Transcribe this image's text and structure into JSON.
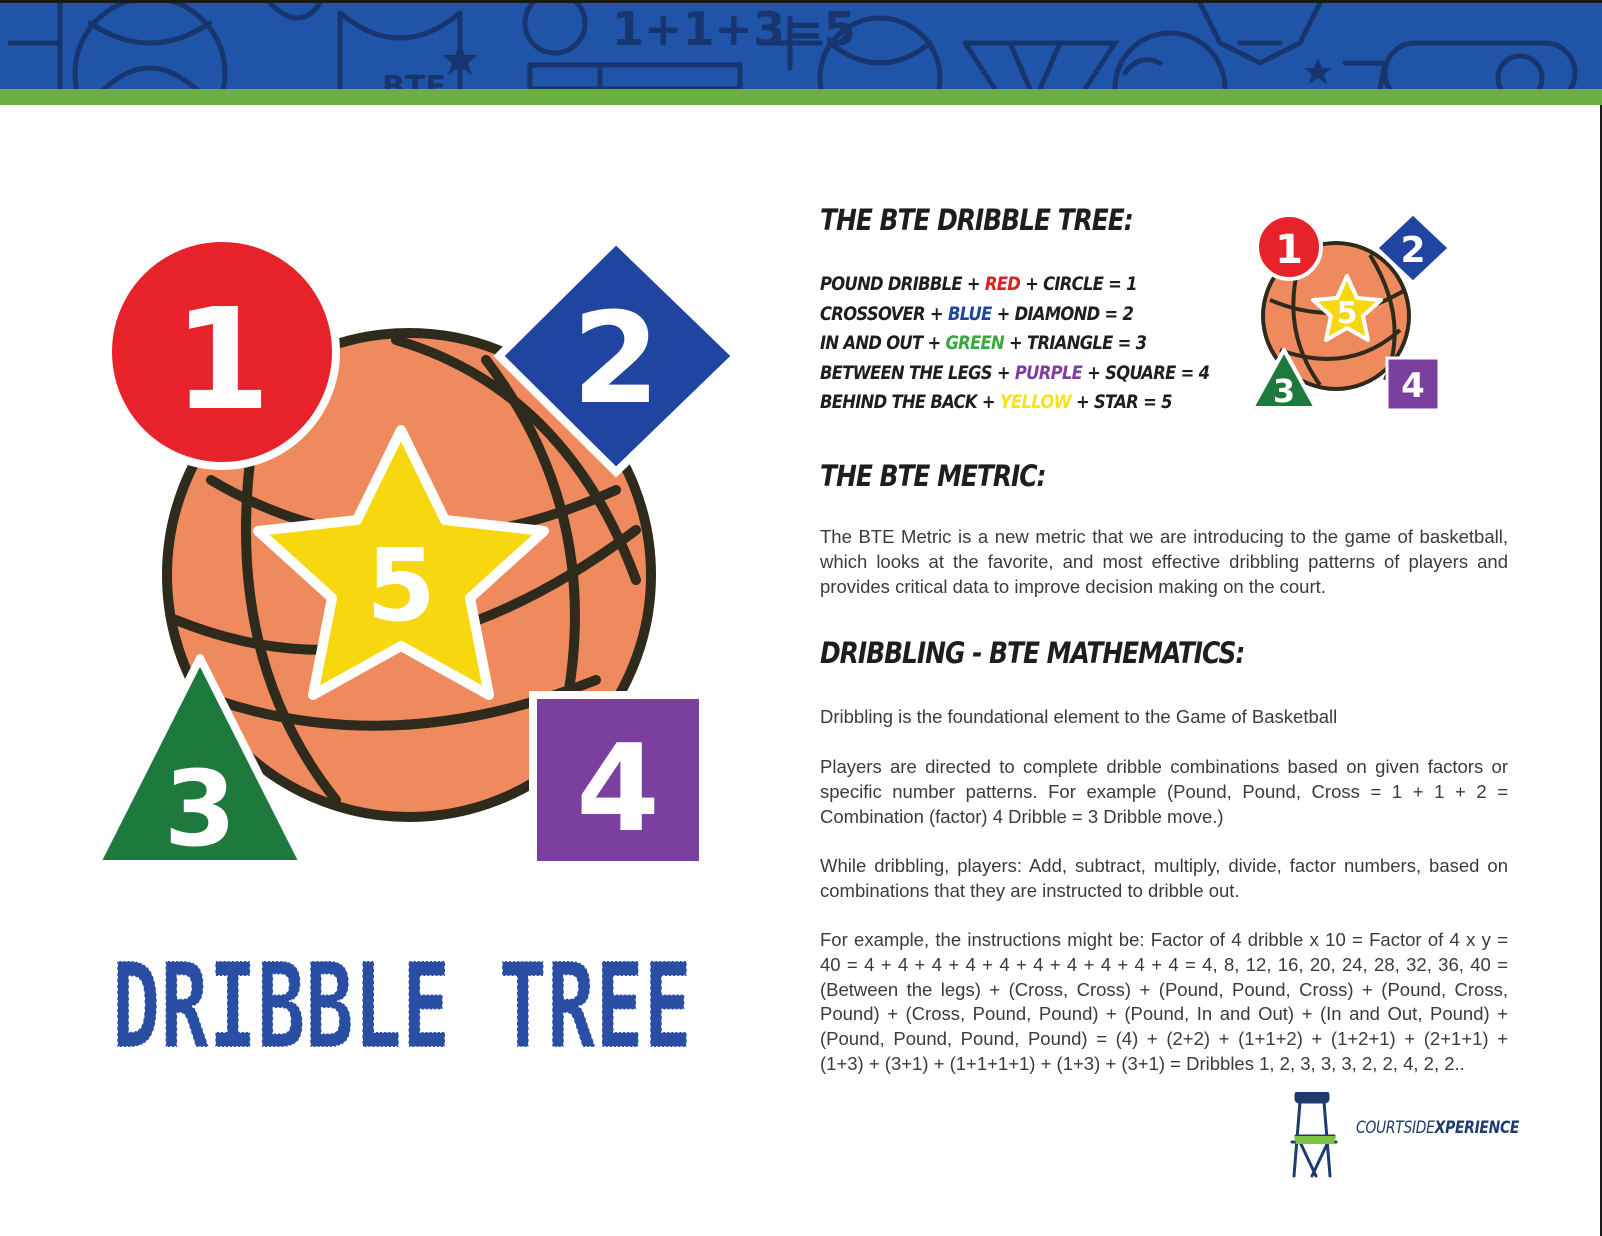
{
  "banner": {
    "equation": "1+1+3=5",
    "jersey_text": "BTE"
  },
  "tree": {
    "heading": "THE BTE DRIBBLE TREE:",
    "rows": [
      {
        "move": "POUND DRIBBLE + ",
        "color_word": "RED",
        "color": "#e02020",
        "rest": " + CIRCLE = 1"
      },
      {
        "move": "CROSSOVER + ",
        "color_word": "BLUE",
        "color": "#1f45a0",
        "rest": " + DIAMOND = 2"
      },
      {
        "move": "IN AND OUT + ",
        "color_word": "GREEN",
        "color": "#3aa83a",
        "rest": " + TRIANGLE = 3"
      },
      {
        "move": "BETWEEN THE LEGS + ",
        "color_word": "PURPLE",
        "color": "#7b3fa0",
        "rest": " + SQUARE = 4"
      },
      {
        "move": "BEHIND THE BACK + ",
        "color_word": "YELLOW",
        "color": "#f5e21a",
        "rest": " + STAR = 5"
      }
    ]
  },
  "metric": {
    "heading": "THE BTE METRIC:",
    "text": "The BTE Metric is a new metric that we are introducing to the game of basketball, which looks at the favorite, and most effective dribbling patterns of players and provides critical data to improve decision making on the court."
  },
  "math": {
    "heading": "DRIBBLING - BTE MATHEMATICS:",
    "p1": "Dribbling is the foundational element to the Game of Basketball",
    "p2": "Players are directed to complete dribble combinations based on given factors or specific number patterns. For example (Pound, Pound, Cross = 1 + 1 + 2 = Combination (factor) 4 Dribble = 3 Dribble move.)",
    "p3": "While dribbling, players: Add, subtract, multiply, divide, factor numbers, based on combinations that they are instructed to dribble out.",
    "p4": "For example, the instructions might be: Factor of 4 dribble x 10 = Factor of 4 x y = 40  = 4 + 4 + 4 + 4 + 4 + 4 + 4 + 4 + 4 + 4 = 4, 8, 12, 16, 20, 24, 28, 32, 36, 40 = (Between the legs) + (Cross, Cross)  + (Pound, Pound, Cross) + (Pound, Cross, Pound) + (Cross, Pound, Pound) + (Pound, In and Out) + (In and Out, Pound) + (Pound, Pound, Pound, Pound) = (4) + (2+2) + (1+1+2) + (1+2+1) + (2+1+1) + (1+3) + (3+1) + (1+1+1+1) + (1+3) + (3+1) = Dribbles 1, 2, 3, 3, 3, 2, 2, 4, 2, 2.."
  },
  "art": {
    "title": "DRIBBLE TREE",
    "circle_num": "1",
    "diamond_num": "2",
    "triangle_num": "3",
    "square_num": "4",
    "star_num": "5",
    "colors": {
      "red": "#e8222a",
      "blue": "#1f45a0",
      "green": "#1e7a3c",
      "purple": "#7b3fa0",
      "yellow": "#f7d80f",
      "ball": "#ef8a5e",
      "seam": "#2e2a1c",
      "title": "#2a4ea3"
    }
  },
  "logo": {
    "word1": "COURTSIDE",
    "word2": "XPERIENCE"
  }
}
